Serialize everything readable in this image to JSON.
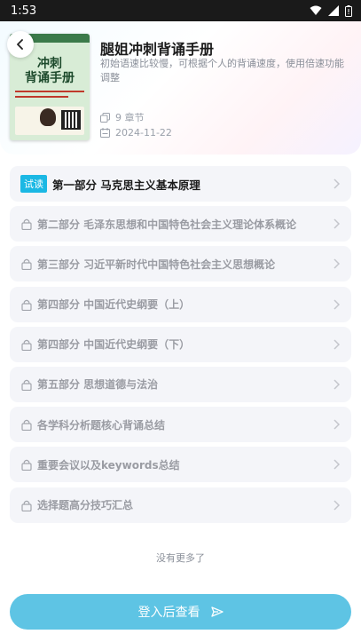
{
  "status_bar": {
    "time": "1:53"
  },
  "book": {
    "title": "腿姐冲刺背诵手册",
    "description": "初始语速比较慢，可根据个人的背诵速度，使用倍速功能调整",
    "chapters": "9 章节",
    "date": "2024-11-22",
    "cover": {
      "title_line1": "冲刺",
      "title_line2": "背诵手册"
    }
  },
  "chapters": [
    {
      "label": "第一部分 马克思主义基本原理",
      "badge": "试读",
      "locked": false
    },
    {
      "label": "第二部分 毛泽东思想和中国特色社会主义理论体系概论",
      "locked": true
    },
    {
      "label": "第三部分 习近平新时代中国特色社会主义思想概论",
      "locked": true
    },
    {
      "label": "第四部分 中国近代史纲要（上）",
      "locked": true
    },
    {
      "label": "第四部分 中国近代史纲要（下）",
      "locked": true
    },
    {
      "label": "第五部分 思想道德与法治",
      "locked": true
    },
    {
      "label": "各学科分析题核心背诵总结",
      "locked": true
    },
    {
      "label": "重要会议以及keywords总结",
      "locked": true
    },
    {
      "label": "选择题高分技巧汇总",
      "locked": true
    }
  ],
  "footer": {
    "no_more": "没有更多了",
    "login_button": "登入后查看"
  },
  "colors": {
    "accent": "#5ec4e4",
    "badge": "#1bb8e4",
    "item_bg": "#f4f5f9",
    "muted_text": "#9a9ca3"
  }
}
